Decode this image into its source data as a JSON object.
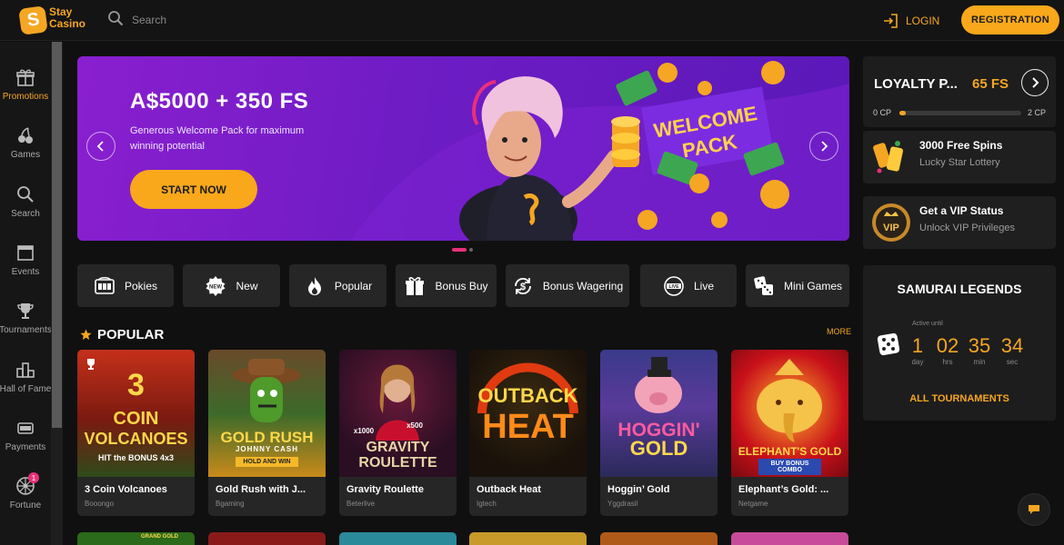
{
  "header": {
    "logo_line1": "Stay",
    "logo_line2": "Casino",
    "search_placeholder": "Search",
    "login_label": "LOGIN",
    "registration_label": "REGISTRATION"
  },
  "sidebar": {
    "items": [
      {
        "label": "Promotions",
        "icon": "gift-icon",
        "active": true
      },
      {
        "label": "Games",
        "icon": "cherries-icon"
      },
      {
        "label": "Search",
        "icon": "search-icon"
      },
      {
        "label": "Events",
        "icon": "calendar-icon"
      },
      {
        "label": "Tournaments",
        "icon": "trophy-icon"
      },
      {
        "label": "Hall of Fame",
        "icon": "podium-icon"
      },
      {
        "label": "Payments",
        "icon": "wallet-icon"
      },
      {
        "label": "Fortune",
        "icon": "wheel-icon",
        "badge": "1"
      }
    ]
  },
  "banner": {
    "title": "A$5000 + 350 FS",
    "subtitle": "Generous Welcome Pack for maximum winning potential",
    "cta_label": "START NOW",
    "sign_line1": "WELCOME",
    "sign_line2": "PACK"
  },
  "categories": [
    {
      "label": "Pokies",
      "icon": "slot-machine-icon"
    },
    {
      "label": "New",
      "icon": "new-badge-icon"
    },
    {
      "label": "Popular",
      "icon": "flame-icon"
    },
    {
      "label": "Bonus Buy",
      "icon": "gift-box-icon"
    },
    {
      "label": "Bonus Wagering",
      "icon": "dollar-cycle-icon"
    },
    {
      "label": "Live",
      "icon": "live-icon"
    },
    {
      "label": "Mini Games",
      "icon": "dice-icon"
    }
  ],
  "popular": {
    "title": "POPULAR",
    "more_label": "MORE",
    "games": [
      {
        "name": "3 Coin Volcanoes",
        "provider": "Booongo",
        "art": [
          "3",
          "COIN",
          "VOLCANOES",
          "HIT the BONUS 4x3"
        ]
      },
      {
        "name": "Gold Rush with J...",
        "provider": "Bgaming",
        "art": [
          "GOLD RUSH",
          "JOHNNY CASH",
          "HOLD AND WIN"
        ]
      },
      {
        "name": "Gravity Roulette",
        "provider": "Beterlive",
        "art": [
          "x1000",
          "x500",
          "GRAVITY",
          "ROULETTE"
        ]
      },
      {
        "name": "Outback Heat",
        "provider": "Igtech",
        "art": [
          "OUTBACK",
          "HEAT"
        ]
      },
      {
        "name": "Hoggin’ Gold",
        "provider": "Yggdrasil",
        "art": [
          "HOGGIN'",
          "GOLD"
        ]
      },
      {
        "name": "Elephant’s Gold: ...",
        "provider": "Netgame",
        "art": [
          "ELEPHANT'S GOLD",
          "BUY BONUS COMBO"
        ]
      }
    ],
    "row2_art": "GRAND GOLD"
  },
  "loyalty": {
    "title": "LOYALTY P...",
    "fs_value": "65 FS",
    "cp_start": "0 CP",
    "cp_end": "2 CP",
    "progress_fraction": 0.05
  },
  "promos": [
    {
      "title": "3000 Free Spins",
      "subtitle": "Lucky Star Lottery",
      "icon": "lottery-tickets-icon"
    },
    {
      "title": "Get a VIP Status",
      "subtitle": "Unlock VIP Privileges",
      "icon": "vip-crown-icon",
      "badge_text": "VIP"
    }
  ],
  "tournament": {
    "title": "SAMURAI LEGENDS",
    "active_until_label": "Active until",
    "countdown": [
      {
        "value": "1",
        "unit": "day"
      },
      {
        "value": "02",
        "unit": "hrs"
      },
      {
        "value": "35",
        "unit": "min"
      },
      {
        "value": "34",
        "unit": "sec"
      }
    ],
    "all_label": "ALL TOURNAMENTS"
  },
  "colors": {
    "accent": "#f9a81b",
    "banner": "#7a1fcc",
    "pink": "#e8307a"
  }
}
